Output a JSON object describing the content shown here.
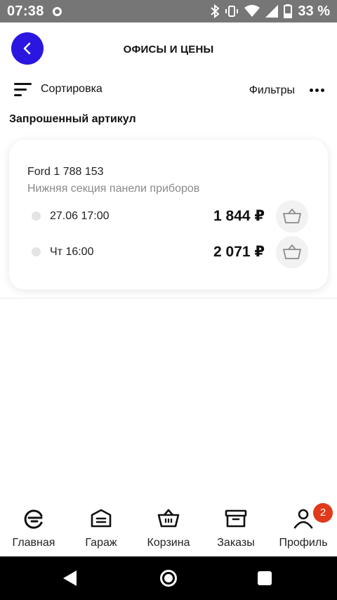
{
  "status_bar": {
    "time": "07:38",
    "battery_percent": "33 %",
    "icons": [
      "sync-circle-icon",
      "bluetooth-icon",
      "vibrate-icon",
      "wifi-icon",
      "signal-icon",
      "battery-icon"
    ]
  },
  "header": {
    "title": "ОФИСЫ И ЦЕНЫ",
    "back_icon": "chevron-left-icon",
    "accent_color": "#2a16e0"
  },
  "toolbar": {
    "sort_label": "Сортировка",
    "filters_label": "Фильтры",
    "more_icon": "more-horizontal-icon"
  },
  "section": {
    "heading": "Запрошенный артикул"
  },
  "product": {
    "brand_article": "Ford 1 788 153",
    "description": "Нижняя секция панели приборов",
    "offers": [
      {
        "date": "27.06 17:00",
        "price": "1 844 ₽"
      },
      {
        "date": "Чт 16:00",
        "price": "2 071 ₽"
      }
    ]
  },
  "bottom_nav": {
    "items": [
      {
        "label": "Главная",
        "icon": "home-logo-icon"
      },
      {
        "label": "Гараж",
        "icon": "garage-icon"
      },
      {
        "label": "Корзина",
        "icon": "basket-icon"
      },
      {
        "label": "Заказы",
        "icon": "orders-box-icon"
      },
      {
        "label": "Профиль",
        "icon": "profile-icon"
      }
    ],
    "profile_badge": "2",
    "badge_color": "#e03a1b"
  }
}
